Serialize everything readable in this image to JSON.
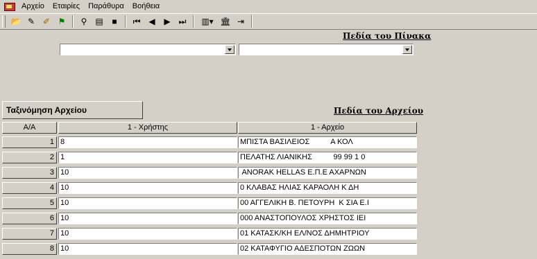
{
  "menu": {
    "items": [
      "Αρχείο",
      "Εταιρίες",
      "Παράθυρα",
      "Βοήθεια"
    ]
  },
  "toolbar": {
    "buttons": [
      {
        "name": "open-folder-icon",
        "glyph": "📂"
      },
      {
        "name": "eraser-icon",
        "glyph": "✎"
      },
      {
        "name": "edit-pencil-icon",
        "glyph": "✐"
      },
      {
        "name": "flag-icon",
        "glyph": "⚑"
      },
      {
        "name": "binoculars-icon",
        "glyph": "⚲"
      },
      {
        "name": "form-icon",
        "glyph": "▤"
      },
      {
        "name": "save-icon",
        "glyph": "■"
      },
      {
        "name": "first-record-icon",
        "glyph": "⏮"
      },
      {
        "name": "previous-record-icon",
        "glyph": "◀"
      },
      {
        "name": "next-record-icon",
        "glyph": "▶"
      },
      {
        "name": "last-record-icon",
        "glyph": "⏭"
      },
      {
        "name": "view-toggle-icon",
        "glyph": "▥▾"
      },
      {
        "name": "bank-icon",
        "glyph": "🏛"
      },
      {
        "name": "exit-door-icon",
        "glyph": "⇥"
      }
    ]
  },
  "main": {
    "table_fields_title": "Πεδία του Πίνακα",
    "file_fields_title": "Πεδία του Αρχείου",
    "combo_left_value": "",
    "combo_right_value": "",
    "sort_button_label": "Ταξινόμηση Αρχείου"
  },
  "grid": {
    "headers": [
      "A/A",
      "1 - Χρήστης",
      "1 - Αρχείο"
    ],
    "rows": [
      {
        "num": "1",
        "user": "8",
        "file": "ΜΠΙΣΤΑ ΒΑΣΙΛΕΙΟΣ          Α ΚΟΛ"
      },
      {
        "num": "2",
        "user": "1",
        "file": "ΠΕΛΑΤΗΣ ΛΙΑΝΙΚΗΣ          99 99 1 0"
      },
      {
        "num": "3",
        "user": "10",
        "file": " ANORAK HELLAS Ε.Π.Ε ΑΧΑΡΝΩΝ"
      },
      {
        "num": "4",
        "user": "10",
        "file": "0 ΚΛΑΒΑΣ ΗΛΙΑΣ ΚΑΡΑΟΛΗ Κ ΔΗ"
      },
      {
        "num": "5",
        "user": "10",
        "file": "00 ΑΓΓΕΛΙΚΗ Β. ΠΕΤΟΥΡΗ  Κ ΣΙΑ Ε.Ι"
      },
      {
        "num": "6",
        "user": "10",
        "file": "000 ΑΝΑΣΤΟΠΟΥΛΟΣ ΧΡΗΣΤΟΣ ΙΕΙ"
      },
      {
        "num": "7",
        "user": "10",
        "file": "01 ΚΑΤΑΣΚ/ΚΗ ΕΛ/ΝΟΣ ΔΗΜΗΤΡΙΟΥ"
      },
      {
        "num": "8",
        "user": "10",
        "file": "02 ΚΑΤΑΦΥΓΙΟ ΑΔΕΣΠΟΤΩΝ ΖΩΩΝ"
      }
    ]
  }
}
